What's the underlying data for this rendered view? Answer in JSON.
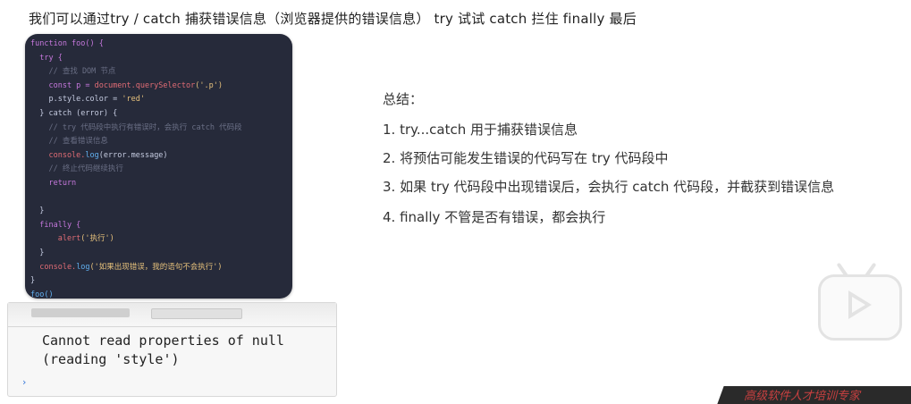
{
  "header": {
    "title": "我们可以通过try / catch 捕获错误信息（浏览器提供的错误信息）  try 试试   catch 拦住  finally  最后"
  },
  "code": {
    "line_1": "function foo() {",
    "line_2": "  try {",
    "line_3": "    // 查找 DOM 节点",
    "line_4a": "    const p = ",
    "line_4b": "document.querySelector",
    "line_4c": "('.p')",
    "line_5a": "    p.style.color = ",
    "line_5b": "'red'",
    "line_6": "  } catch (error) {",
    "line_7": "    // try 代码段中执行有错误时，会执行 catch 代码段",
    "line_8": "    // 查看错误信息",
    "line_9a": "    console.",
    "line_9b": "log",
    "line_9c": "(error.message)",
    "line_10": "    // 终止代码继续执行",
    "line_11": "    return",
    "line_12": "",
    "line_13": "  }",
    "line_14": "  finally {",
    "line_15a": "      alert",
    "line_15b": "('执行')",
    "line_16": "  }",
    "line_17a": "  console.",
    "line_17b": "log",
    "line_17c": "('如果出现错误，我的语句不会执行')",
    "line_18": "}",
    "line_19": "foo()"
  },
  "console": {
    "error_line_1": "Cannot read properties of null",
    "error_line_2": "(reading 'style')",
    "prompt": "›"
  },
  "summary": {
    "title": "总结：",
    "items": [
      "1. try...catch 用于捕获错误信息",
      "2. 将预估可能发生错误的代码写在 try 代码段中",
      "3. 如果 try 代码段中出现错误后，会执行 catch 代码段，并截获到错误信息",
      "4. finally  不管是否有错误，都会执行"
    ]
  },
  "footer": {
    "text": "高级软件人才培训专家"
  },
  "colors": {
    "code_bg": "#262a3a",
    "keyword": "#c678dd",
    "function": "#61afef",
    "string": "#e5c07b",
    "comment": "#6a6f85",
    "footer_text": "#c94040"
  }
}
